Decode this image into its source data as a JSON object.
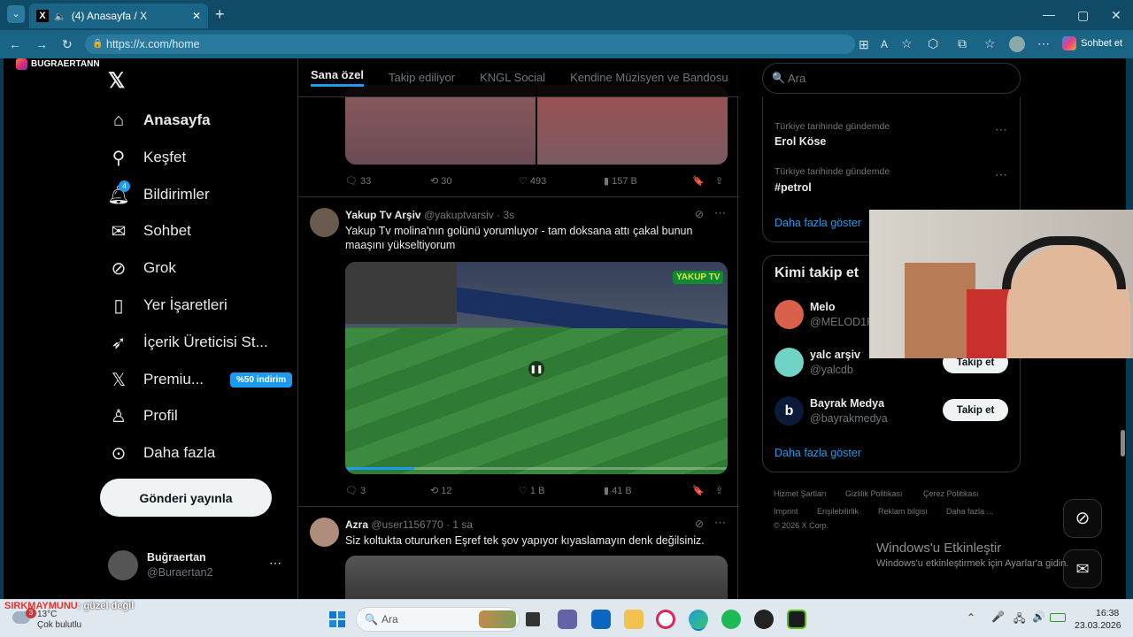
{
  "browser": {
    "tab_title": "(4) Anasayfa / X",
    "url": "https://x.com/home",
    "chat_button": "Sohbet et"
  },
  "overlay_name": "BUGRAERTANN",
  "nav": {
    "items": [
      {
        "label": "Anasayfa",
        "icon": "home-icon",
        "bold": true
      },
      {
        "label": "Keşfet",
        "icon": "search-icon"
      },
      {
        "label": "Bildirimler",
        "icon": "bell-icon",
        "badge": "4"
      },
      {
        "label": "Sohbet",
        "icon": "mail-icon"
      },
      {
        "label": "Grok",
        "icon": "grok-icon"
      },
      {
        "label": "Yer İşaretleri",
        "icon": "bookmark-icon"
      },
      {
        "label": "İçerik Üreticisi St...",
        "icon": "rocket-icon"
      },
      {
        "label": "Premiu...",
        "icon": "x-logo-icon",
        "badge_text": "%50 indirim"
      },
      {
        "label": "Profil",
        "icon": "person-icon"
      },
      {
        "label": "Daha fazla",
        "icon": "more-circle-icon"
      }
    ],
    "post_button": "Gönderi yayınla",
    "account": {
      "name": "Buğraertan",
      "handle": "@Buraertan2"
    }
  },
  "feed": {
    "tabs": [
      "Sana özel",
      "Takip ediliyor",
      "KNGL Social",
      "Kendine Müzisyen ve Bandosu"
    ],
    "tweets": [
      {
        "replies": "33",
        "retweets": "30",
        "likes": "493",
        "views": "157 B"
      },
      {
        "name": "Yakup Tv Arşiv",
        "handle": "@yakuptvarsiv",
        "time": "· 3s",
        "text": "Yakup Tv molina'nın golünü yorumluyor - tam doksana attı çakal bunun maaşını yükseltiyorum",
        "replies": "3",
        "retweets": "12",
        "likes": "1 B",
        "views": "41 B",
        "video_brand": "YAKUP TV"
      },
      {
        "name": "Azra",
        "handle": "@user1156770",
        "time": "· 1 sa",
        "text": "Siz koltukta otururken Eşref tek şov yapıyor kıyaslamayın denk değilsiniz."
      }
    ]
  },
  "right": {
    "search_placeholder": "Ara",
    "trends": [
      {
        "meta": "Türkiye tarihinde gündemde",
        "name": "Erol Köse"
      },
      {
        "meta": "Türkiye tarihinde gündemde",
        "name": "#petrol"
      }
    ],
    "show_more": "Daha fazla göster",
    "who_to_follow_title": "Kimi takip et",
    "follow": [
      {
        "name": "Melo",
        "handle": "@MELOD1P"
      },
      {
        "name": "yalc arşiv",
        "handle": "@yalcdb",
        "button": "Takip et"
      },
      {
        "name": "Bayrak Medya",
        "handle": "@bayrakmedya",
        "button": "Takip et"
      }
    ],
    "show_more2": "Daha fazla göster",
    "footer": [
      "Hizmet Şartları",
      "Gizlilik Politikası",
      "Çerez Politikası",
      "Imprint",
      "Erişilebilirlik",
      "Reklam bilgisi",
      "Daha fazla ...",
      "© 2026 X Corp."
    ]
  },
  "windows_activation": {
    "title": "Windows'u Etkinleştir",
    "subtitle": "Windows'u etkinleştirmek için Ayarlar'a gidin."
  },
  "taskbar": {
    "weather_temp": "13°C",
    "weather_text": "Çok bulutlu",
    "weather_badge": "3",
    "search": "Ara",
    "time": "16:38",
    "date": "23.03.2026",
    "chat_overlay": {
      "user": "SIRKMAYMUNU",
      "message": ": güzel değil"
    }
  }
}
